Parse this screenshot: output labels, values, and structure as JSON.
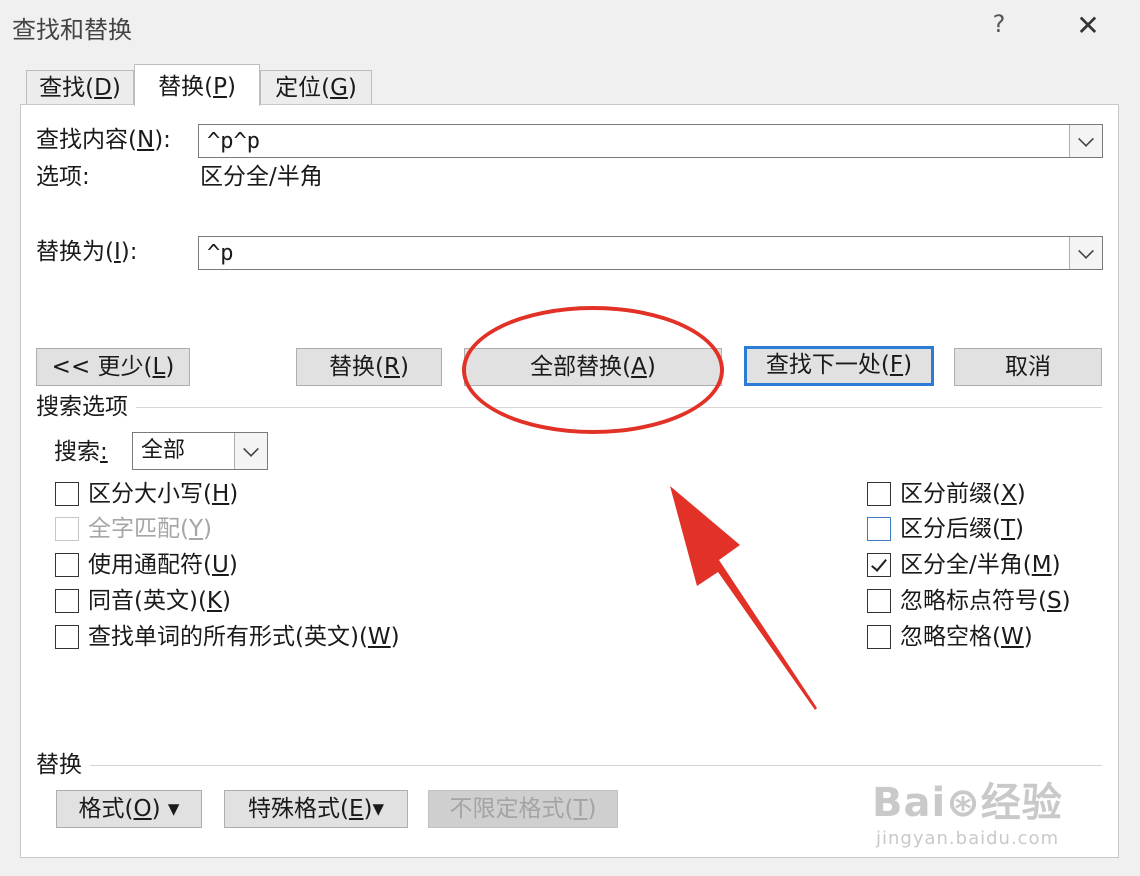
{
  "window": {
    "title": "查找和替换",
    "help": "?",
    "close": "✕"
  },
  "tabs": [
    {
      "label": "查找(",
      "key": "D",
      "suffix": ")"
    },
    {
      "label": "替换(",
      "key": "P",
      "suffix": ")"
    },
    {
      "label": "定位(",
      "key": "G",
      "suffix": ")"
    }
  ],
  "find": {
    "label": "查找内容(",
    "key": "N",
    "suffix": "):",
    "value": "^p^p"
  },
  "options": {
    "label": "选项:",
    "value": "区分全/半角"
  },
  "replace": {
    "label": "替换为(",
    "key": "I",
    "suffix": "):",
    "value": "^p"
  },
  "buttons": {
    "less": {
      "label": "<< 更少(",
      "key": "L",
      "suffix": ")"
    },
    "replace": {
      "label": "替换(",
      "key": "R",
      "suffix": ")"
    },
    "replace_all": {
      "label": "全部替换(",
      "key": "A",
      "suffix": ")"
    },
    "find_next": {
      "label": "查找下一处(",
      "key": "F",
      "suffix": ")"
    },
    "cancel": {
      "label": "取消"
    }
  },
  "search_options": {
    "heading": "搜索选项",
    "search_label": "搜索",
    "search_key": ":",
    "search_value": "全部",
    "left": [
      {
        "label": "区分大小写(",
        "key": "H",
        "suffix": ")",
        "checked": false,
        "disabled": false
      },
      {
        "label": "全字匹配(",
        "key": "Y",
        "suffix": ")",
        "checked": false,
        "disabled": true
      },
      {
        "label": "使用通配符(",
        "key": "U",
        "suffix": ")",
        "checked": false,
        "disabled": false
      },
      {
        "label": "同音(英文)(",
        "key": "K",
        "suffix": ")",
        "checked": false,
        "disabled": false
      },
      {
        "label": "查找单词的所有形式(英文)(",
        "key": "W",
        "suffix": ")",
        "checked": false,
        "disabled": false
      }
    ],
    "right": [
      {
        "label": "区分前缀(",
        "key": "X",
        "suffix": ")",
        "checked": false
      },
      {
        "label": "区分后缀(",
        "key": "T",
        "suffix": ")",
        "checked": false
      },
      {
        "label": "区分全/半角(",
        "key": "M",
        "suffix": ")",
        "checked": true
      },
      {
        "label": "忽略标点符号(",
        "key": "S",
        "suffix": ")",
        "checked": false
      },
      {
        "label": "忽略空格(",
        "key": "W",
        "suffix": ")",
        "checked": false
      }
    ]
  },
  "replace_section": {
    "heading": "替换",
    "format": {
      "label": "格式(",
      "key": "O",
      "suffix": ") ▾"
    },
    "special": {
      "label": "特殊格式(",
      "key": "E",
      "suffix": ")▾"
    },
    "no_format": {
      "label": "不限定格式(",
      "key": "T",
      "suffix": ")"
    }
  },
  "annotation": {
    "color": "#e23126"
  },
  "watermark": {
    "brand": "Bai⊛经验",
    "url": "jingyan.baidu.com"
  }
}
